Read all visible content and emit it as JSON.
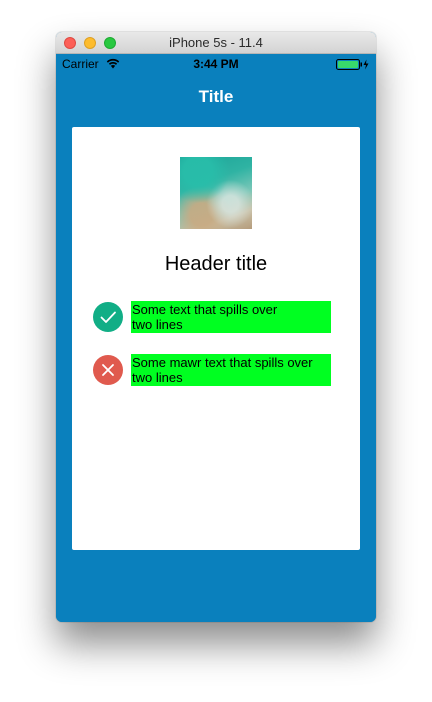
{
  "window": {
    "title": "iPhone 5s - 11.4"
  },
  "status_bar": {
    "carrier": "Carrier",
    "time": "3:44 PM",
    "icons": [
      "wifi-icon",
      "battery-charging-icon"
    ]
  },
  "nav": {
    "title": "Title"
  },
  "card": {
    "image": "header-image",
    "header_title": "Header title",
    "items": [
      {
        "text": "Some text that spills over\ntwo lines",
        "icon": "check-circle-icon",
        "icon_color": "#11ae86"
      },
      {
        "text": "Some mawr text that spills over\ntwo lines",
        "icon": "x-circle-icon",
        "icon_color": "#e05a4e"
      }
    ]
  },
  "colors": {
    "screen_background": "#0a80bd",
    "card_background": "#ffffff",
    "text_highlight": "#00ff21",
    "success": "#11ae86",
    "error": "#e05a4e",
    "battery": "#38d86b"
  }
}
